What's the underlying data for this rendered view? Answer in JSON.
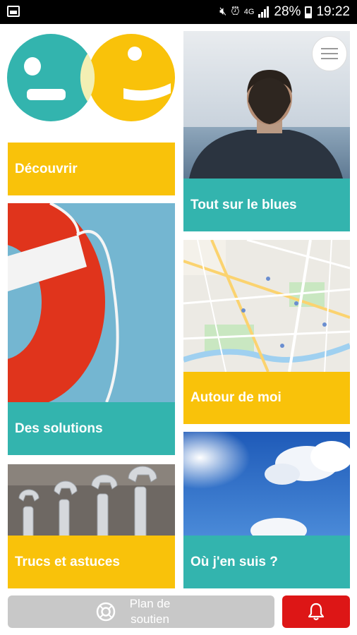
{
  "status_bar": {
    "battery": "28%",
    "time": "19:22",
    "icons": [
      "image-icon",
      "mute-icon",
      "alarm-icon",
      "data-icon",
      "signal-icon",
      "battery-icon"
    ]
  },
  "colors": {
    "teal": "#33b4ae",
    "yellow": "#f9c20a",
    "alert_red": "#dd1616",
    "disabled_gray": "#c8c8c8"
  },
  "tiles": {
    "decouvrir": {
      "label": "Découvrir"
    },
    "blues": {
      "label": "Tout sur le blues",
      "image": "man-facing-sea-photo"
    },
    "solutions": {
      "label": "Des solutions",
      "image": "lifebuoy-photo"
    },
    "autour": {
      "label": "Autour de moi",
      "image": "street-map"
    },
    "trucs": {
      "label": "Trucs et astuces",
      "image": "wrenches-photo"
    },
    "ou": {
      "label": "Où j'en suis ?",
      "image": "sky-photo"
    }
  },
  "bottom": {
    "support_line1": "Plan de",
    "support_line2": "soutien"
  }
}
